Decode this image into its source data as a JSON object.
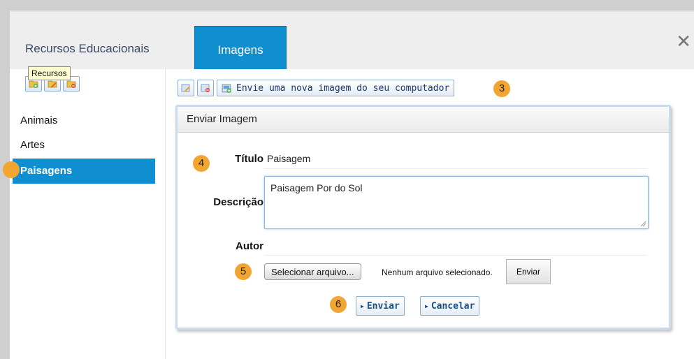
{
  "tabs": [
    {
      "label": "Recursos Educacionais",
      "active": false
    },
    {
      "label": "Imagens",
      "active": true
    }
  ],
  "tooltip": "Recursos",
  "close_icon": "close-icon",
  "sidebar": {
    "tool_icons": [
      "add-folder-icon",
      "edit-folder-icon",
      "delete-folder-icon"
    ],
    "items": [
      {
        "label": "Animais",
        "active": false
      },
      {
        "label": "Artes",
        "active": false
      },
      {
        "label": "Paisagens",
        "active": true
      }
    ]
  },
  "toolbar": {
    "edit_icon": "edit-image-icon",
    "delete_icon": "delete-image-icon",
    "upload_icon": "upload-image-icon",
    "upload_label": "Envie uma nova imagem do seu computador"
  },
  "form": {
    "header": "Enviar Imagem",
    "title_label": "Título",
    "title_value": "Paisagem",
    "desc_label": "Descrição",
    "desc_value": "Paisagem Por do Sol",
    "author_label": "Autor",
    "author_value": "",
    "file_button": "Selecionar arquivo...",
    "file_status": "Nenhum arquivo selecionado.",
    "upload_button": "Enviar",
    "submit_button": "Enviar",
    "cancel_button": "Cancelar"
  },
  "badges": [
    "3",
    "4",
    "5",
    "6"
  ],
  "colors": {
    "accent": "#0f8fd0",
    "badge": "#f3a531"
  }
}
